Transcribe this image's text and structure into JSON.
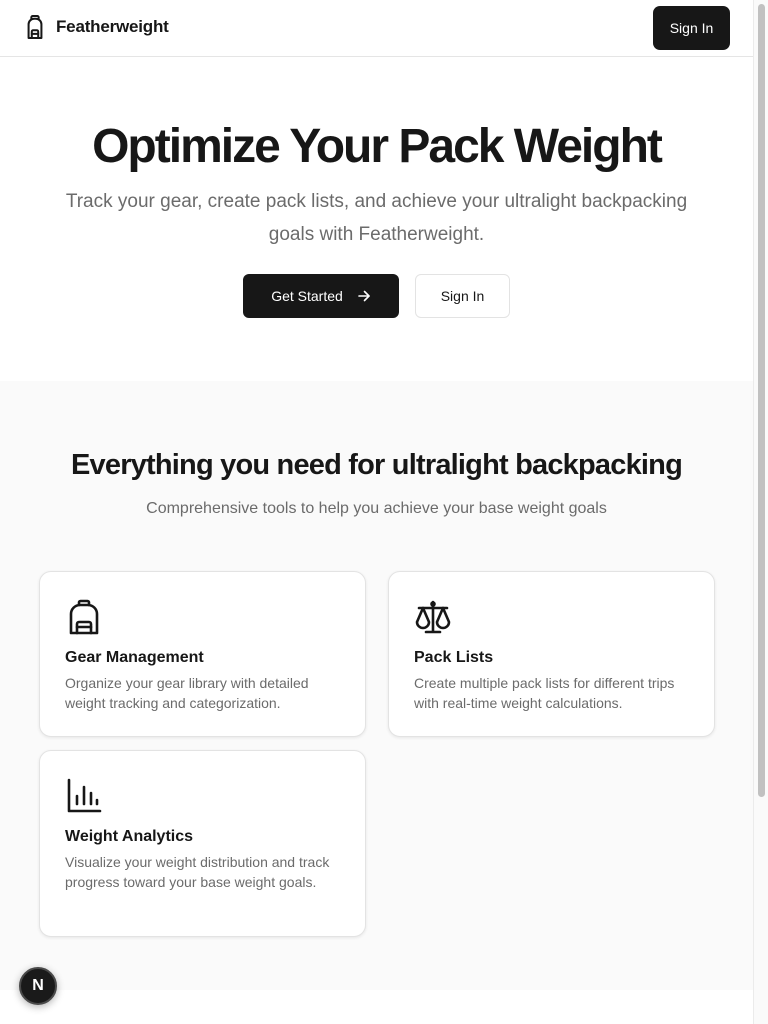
{
  "header": {
    "brand_name": "Featherweight",
    "brand_icon": "backpack-icon",
    "sign_in_label": "Sign In"
  },
  "hero": {
    "title": "Optimize Your Pack Weight",
    "subtitle": "Track your gear, create pack lists, and achieve your ultralight backpacking goals with Featherweight.",
    "primary_label": "Get Started",
    "primary_icon": "arrow-right-icon",
    "secondary_label": "Sign In"
  },
  "features": {
    "title": "Everything you need for ultralight backpacking",
    "subtitle": "Comprehensive tools to help you achieve your base weight goals",
    "cards": [
      {
        "icon": "backpack-icon",
        "title": "Gear Management",
        "description": "Organize your gear library with detailed weight tracking and categorization."
      },
      {
        "icon": "scale-icon",
        "title": "Pack Lists",
        "description": "Create multiple pack lists for different trips with real-time weight calculations."
      },
      {
        "icon": "bar-chart-icon",
        "title": "Weight Analytics",
        "description": "Visualize your weight distribution and track progress toward your base weight goals."
      }
    ]
  },
  "badge": {
    "label": "N"
  },
  "colors": {
    "primary": "#171717",
    "muted_text": "#6b6b6b",
    "section_bg": "#fafafa",
    "border": "#e3e3e3"
  }
}
